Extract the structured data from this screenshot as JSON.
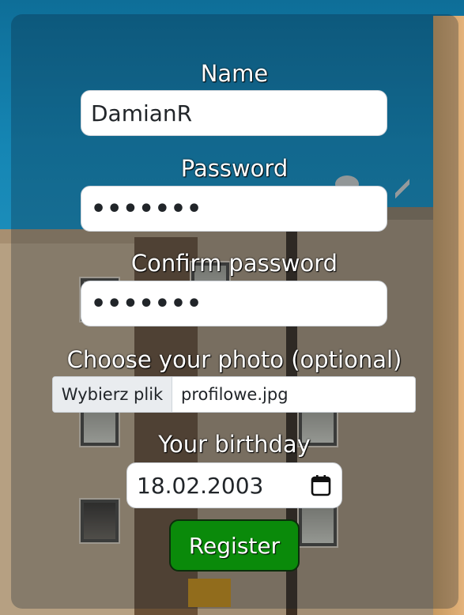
{
  "form": {
    "name": {
      "label": "Name",
      "value": "DamianR"
    },
    "password": {
      "label": "Password",
      "value": "•••••••"
    },
    "confirm_password": {
      "label": "Confirm password",
      "value": "•••••••"
    },
    "photo": {
      "label": "Choose your photo (optional)",
      "button_label": "Wybierz plik",
      "file_name": "profilowe.jpg"
    },
    "birthday": {
      "label": "Your birthday",
      "value": "18.02.2003",
      "icon": "calendar-icon"
    },
    "register_label": "Register"
  },
  "colors": {
    "register_button": "#0a8a0a",
    "label_text": "#ffffff",
    "sky": "#1586b4"
  }
}
